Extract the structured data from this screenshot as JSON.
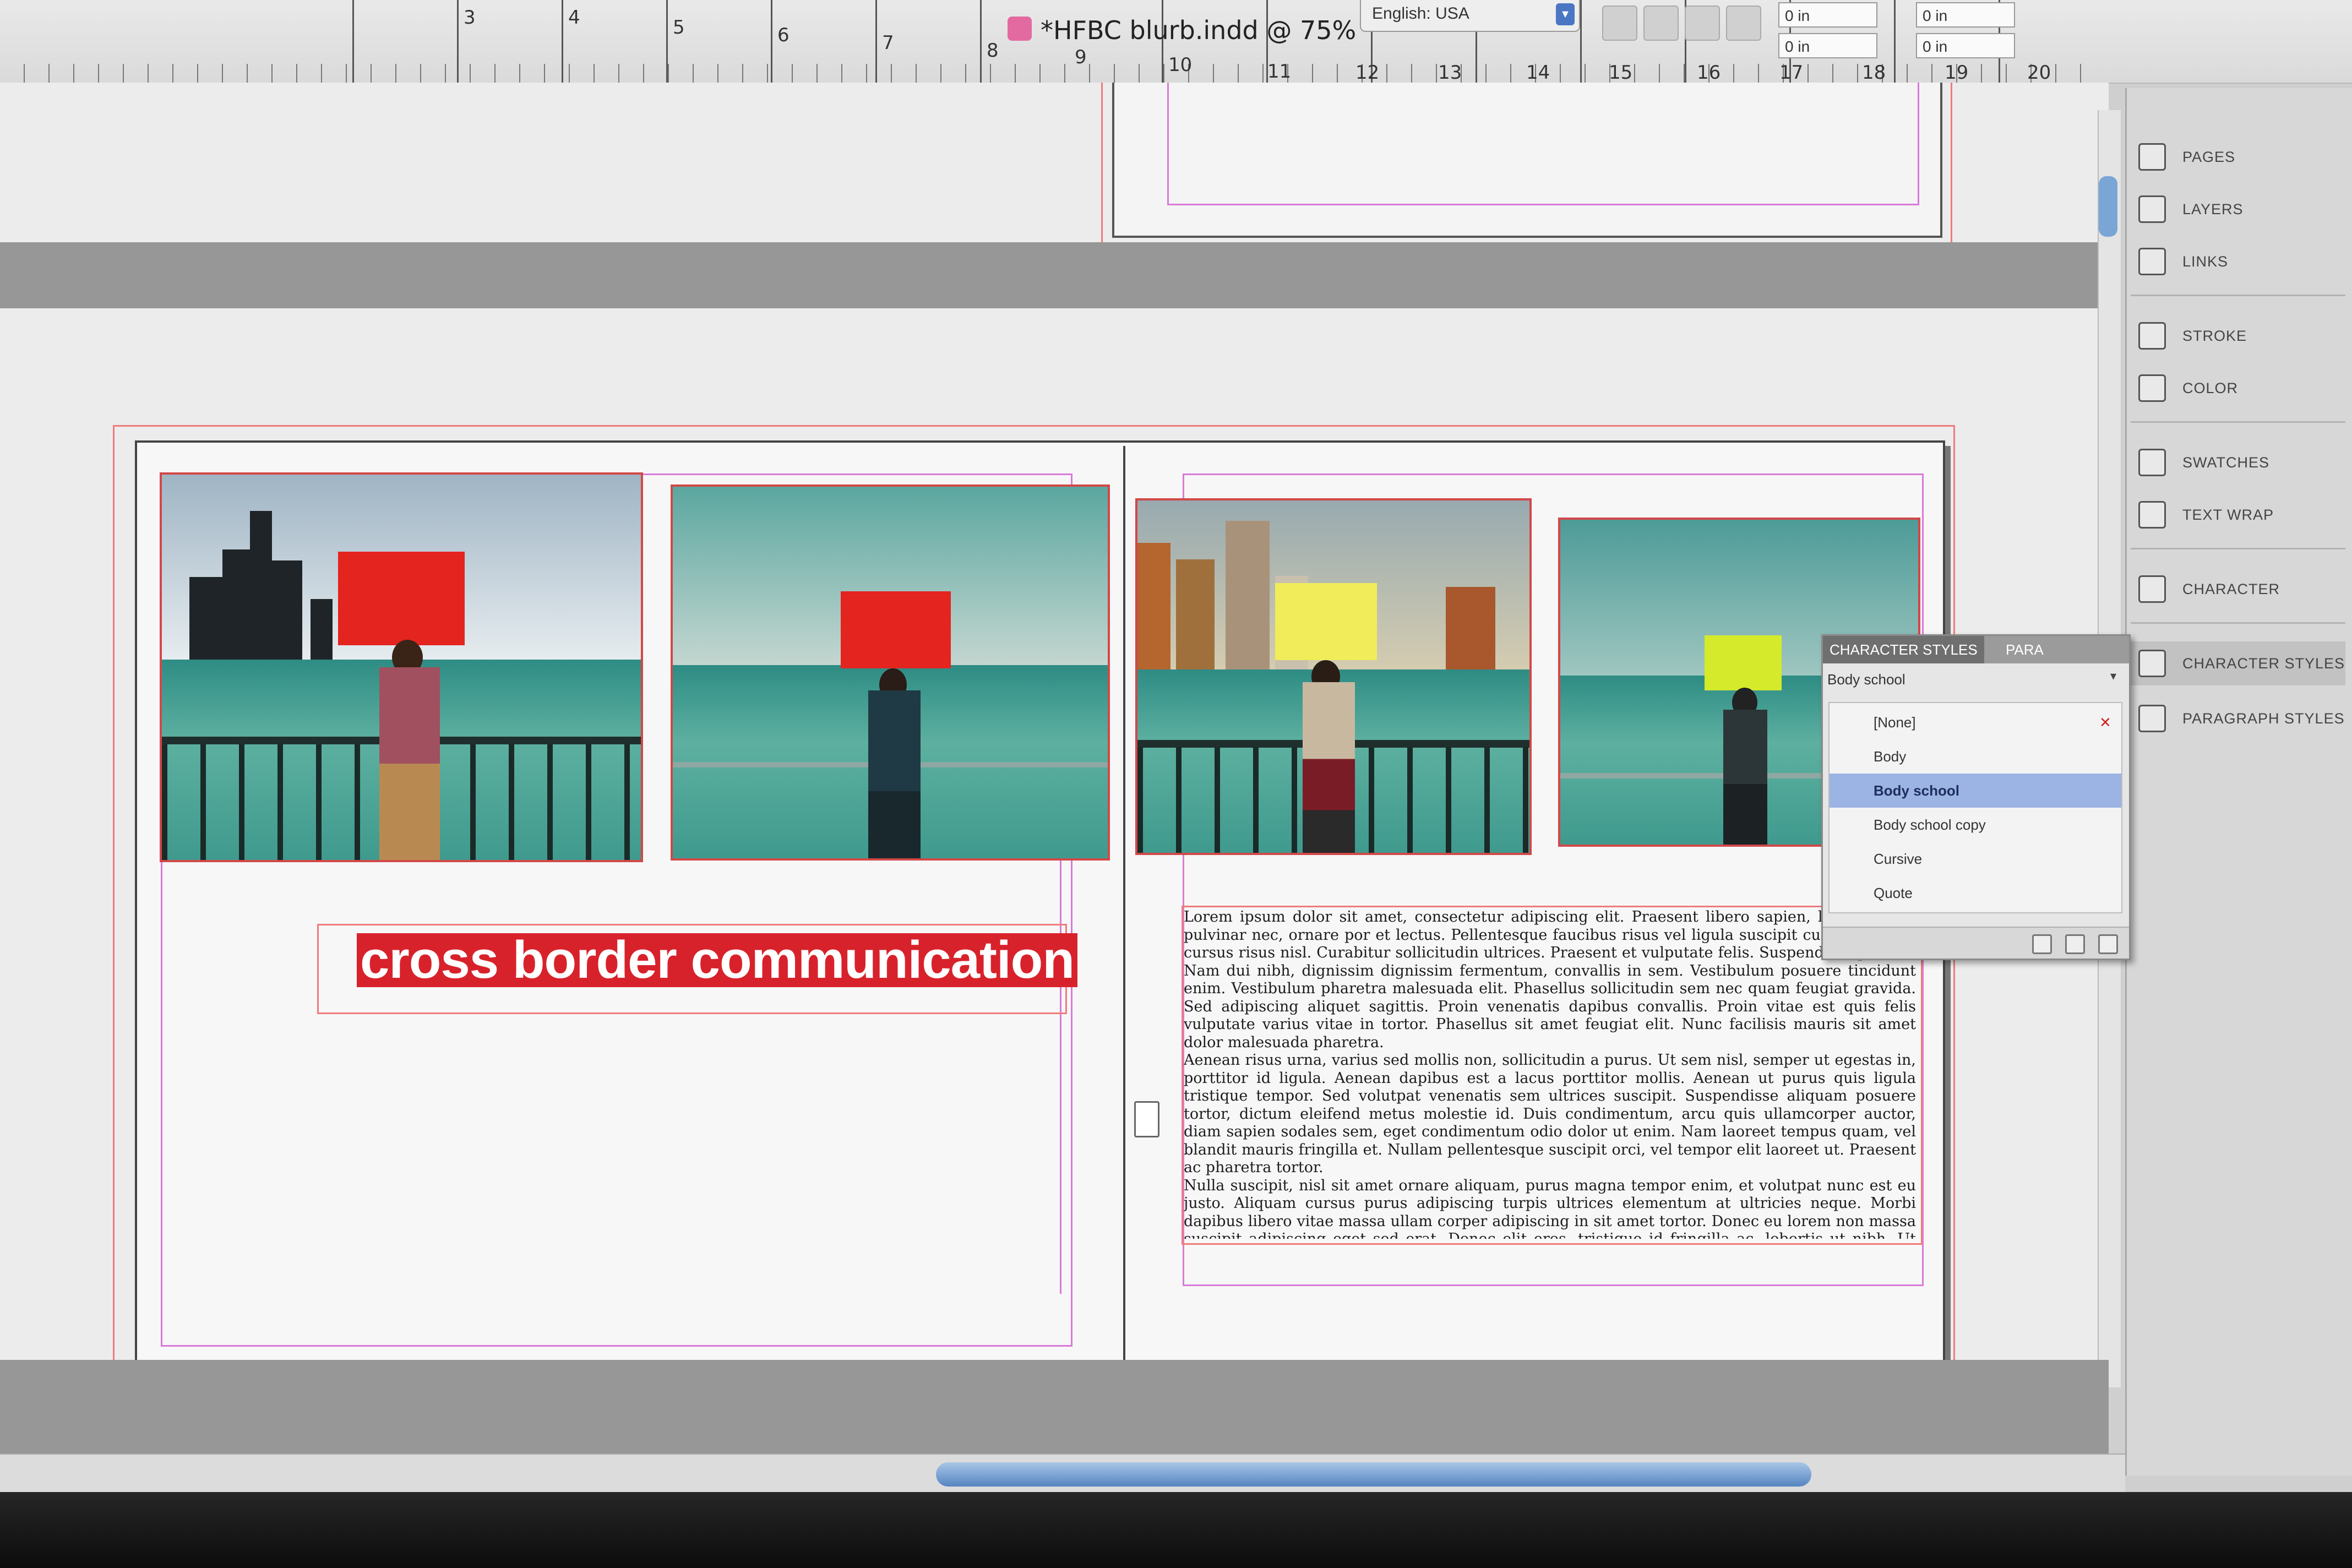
{
  "window": {
    "document_title": "*HFBC blurb.indd @ 75%",
    "language": "English: USA",
    "field_values": [
      "0 in",
      "0 in",
      "0 in",
      "0 in"
    ]
  },
  "ruler": {
    "numbers": [
      "3",
      "4",
      "5",
      "6",
      "7",
      "8",
      "9",
      "10",
      "11",
      "12",
      "13",
      "14",
      "15",
      "16",
      "17",
      "18",
      "19",
      "20"
    ]
  },
  "layout": {
    "headline": "cross border communication",
    "body_paragraphs": [
      "Lorem ipsum dolor sit amet, consectetur adipiscing elit. Praesent libero sapien, lobortis eget pulvinar nec, ornare por et lectus. Pellentesque faucibus risus vel ligula suscipit cursus. Mauris cursus risus nisl. Curabitur sollicitudin ultrices. Praesent et vulputate felis. Suspendisse potenti. Nam dui nibh, dignissim dignissim fermentum, convallis in sem. Vestibulum posuere tincidunt enim. Vestibulum pharetra malesuada elit. Phasellus sollicitudin sem nec quam feugiat gravida. Sed adipiscing aliquet sagittis. Proin venenatis dapibus convallis. Proin vitae est quis felis vulputate varius vitae in tortor. Phasellus sit amet feugiat elit. Nunc facilisis mauris sit amet dolor malesuada pharetra.",
      "Aenean risus urna, varius sed mollis non, sollicitudin a purus. Ut sem nisl, semper ut egestas in, porttitor id ligula. Aenean dapibus est a lacus porttitor mollis. Aenean ut purus quis ligula tristique tempor. Sed volutpat venenatis sem ultrices suscipit. Suspendisse aliquam posuere tortor, dictum eleifend metus molestie id. Duis condimentum, arcu quis ullamcorper auctor, diam sapien sodales sem, eget condimentum odio dolor ut enim. Nam laoreet tempus quam, vel blandit mauris fringilla et. Nullam pellentesque suscipit orci, vel tempor elit laoreet ut. Praesent ac pharetra tortor.",
      "Nulla suscipit, nisl sit amet ornare aliquam, purus magna tempor enim, et volutpat nunc est eu justo. Aliquam cursus purus adipiscing turpis ultrices elementum at ultricies neque. Morbi dapibus libero vitae massa ullam corper adipiscing in sit amet tortor. Donec eu lorem non massa suscipit adipiscing eget sed erat. Donec elit eros, tristique id fringilla ac, lobortis ut nibh. Ut justo mauris, tempus et tempor eget, adipiscing quis leo. Class aptent"
    ],
    "photo_signs": [
      {
        "sign_color": "#e4241f"
      },
      {
        "sign_color": "#e4241f"
      },
      {
        "sign_color": "#f0ec5a"
      },
      {
        "sign_color": "#d4ea2a"
      }
    ]
  },
  "dock": {
    "items": [
      "PAGES",
      "LAYERS",
      "LINKS",
      "STROKE",
      "COLOR",
      "SWATCHES",
      "TEXT WRAP",
      "CHARACTER",
      "CHARACTER STYLES",
      "PARAGRAPH STYLES"
    ]
  },
  "character_styles_panel": {
    "tab_active": "CHARACTER STYLES",
    "tab_other": "PARA",
    "current_style": "Body school",
    "styles": [
      "[None]",
      "Body",
      "Body school",
      "Body school copy",
      "Cursive",
      "Quote"
    ],
    "selected": "Body school"
  },
  "colors": {
    "headline_bg": "#d8222b",
    "selection": "#9cb4e4",
    "margin_guide": "#d97ad9",
    "bleed_guide": "#f07b7b"
  }
}
